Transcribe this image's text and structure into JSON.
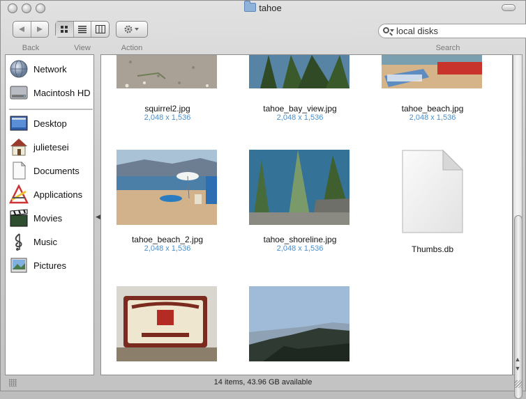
{
  "window": {
    "title": "tahoe"
  },
  "toolbar": {
    "back_label": "Back",
    "view_label": "View",
    "action_label": "Action",
    "search_label": "Search",
    "search_value": "local disks"
  },
  "sidebar": {
    "items": [
      {
        "label": "Network",
        "icon": "network-globe-icon"
      },
      {
        "label": "Macintosh HD",
        "icon": "hard-drive-icon"
      },
      {
        "label": "Desktop",
        "icon": "desktop-icon"
      },
      {
        "label": "julietesei",
        "icon": "home-icon"
      },
      {
        "label": "Documents",
        "icon": "documents-icon"
      },
      {
        "label": "Applications",
        "icon": "applications-icon"
      },
      {
        "label": "Movies",
        "icon": "movies-clapper-icon"
      },
      {
        "label": "Music",
        "icon": "music-note-icon"
      },
      {
        "label": "Pictures",
        "icon": "pictures-icon"
      }
    ]
  },
  "files": [
    {
      "name": "squirrel2.jpg",
      "dims": "2,048 x 1,536"
    },
    {
      "name": "tahoe_bay_view.jpg",
      "dims": "2,048 x 1,536"
    },
    {
      "name": "tahoe_beach.jpg",
      "dims": "2,048 x 1,536"
    },
    {
      "name": "tahoe_beach_2.jpg",
      "dims": "2,048 x 1,536"
    },
    {
      "name": "tahoe_shoreline.jpg",
      "dims": "2,048 x 1,536"
    },
    {
      "name": "Thumbs.db",
      "dims": ""
    },
    {
      "name": "",
      "dims": ""
    },
    {
      "name": "",
      "dims": ""
    }
  ],
  "status": {
    "text": "14 items, 43.96 GB available"
  },
  "colors": {
    "accent_dims": "#4a8ecb"
  }
}
